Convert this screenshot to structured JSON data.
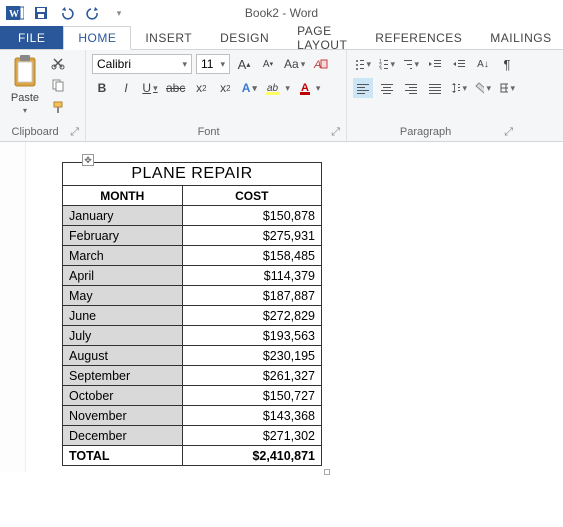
{
  "window": {
    "title": "Book2 - Word"
  },
  "qat": {
    "save": "save",
    "undo": "undo",
    "redo": "redo"
  },
  "tabs": {
    "file": "FILE",
    "home": "HOME",
    "insert": "INSERT",
    "design": "DESIGN",
    "page_layout": "PAGE LAYOUT",
    "references": "REFERENCES",
    "mailings": "MAILINGS"
  },
  "ribbon": {
    "clipboard": {
      "label": "Clipboard",
      "paste": "Paste"
    },
    "font": {
      "label": "Font",
      "name": "Calibri",
      "size": "11"
    },
    "paragraph": {
      "label": "Paragraph"
    }
  },
  "table": {
    "title": "PLANE REPAIR",
    "headers": {
      "month": "MONTH",
      "cost": "COST"
    },
    "rows": [
      {
        "month": "January",
        "cost": "$150,878"
      },
      {
        "month": "February",
        "cost": "$275,931"
      },
      {
        "month": "March",
        "cost": "$158,485"
      },
      {
        "month": "April",
        "cost": "$114,379"
      },
      {
        "month": "May",
        "cost": "$187,887"
      },
      {
        "month": "June",
        "cost": "$272,829"
      },
      {
        "month": "July",
        "cost": "$193,563"
      },
      {
        "month": "August",
        "cost": "$230,195"
      },
      {
        "month": "September",
        "cost": "$261,327"
      },
      {
        "month": "October",
        "cost": "$150,727"
      },
      {
        "month": "November",
        "cost": "$143,368"
      },
      {
        "month": "December",
        "cost": "$271,302"
      }
    ],
    "total": {
      "label": "TOTAL",
      "cost": "$2,410,871"
    }
  }
}
